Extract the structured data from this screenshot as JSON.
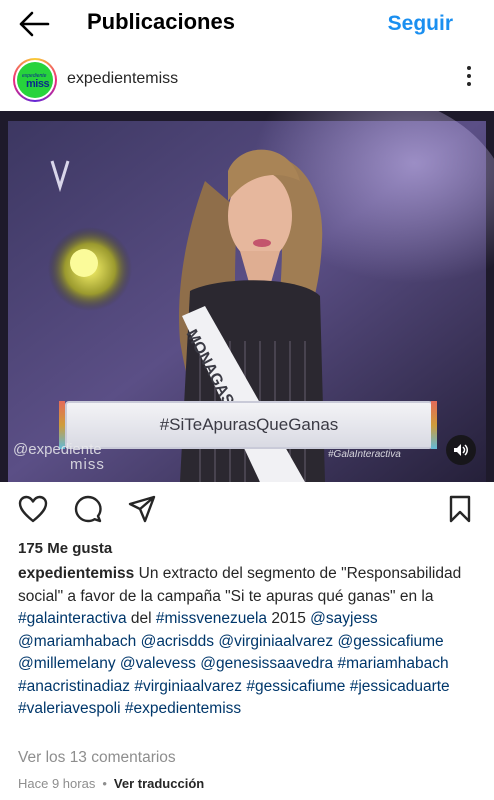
{
  "header": {
    "title": "Publicaciones",
    "follow_label": "Seguir",
    "back_icon": "arrow-left-icon"
  },
  "post": {
    "username": "expedientemiss",
    "avatar": {
      "small_text": "expediente",
      "miss_text": "miss"
    },
    "media": {
      "banner_text": "#SiTeApurasQueGanas",
      "watermark_left": "@expediente",
      "watermark_left_miss": "miss",
      "watermark_right": "#GalaInteractiva",
      "sash_text": "MONAGAS"
    },
    "likes": "175 Me gusta",
    "caption": {
      "username": "expedientemiss",
      "segments": [
        {
          "text": " Un extracto del segmento de \"Responsabilidad social\" a favor de la campaña \"Si te apuras qué ganas\" en la ",
          "link": false
        },
        {
          "text": "#galainteractiva",
          "link": true
        },
        {
          "text": " del ",
          "link": false
        },
        {
          "text": "#missvenezuela",
          "link": true
        },
        {
          "text": " 2015 ",
          "link": false
        },
        {
          "text": "@sayjess",
          "link": true
        },
        {
          "text": " ",
          "link": false
        },
        {
          "text": "@mariamhabach",
          "link": true
        },
        {
          "text": " ",
          "link": false
        },
        {
          "text": "@acrisdds",
          "link": true
        },
        {
          "text": " ",
          "link": false
        },
        {
          "text": "@virginiaalvarez",
          "link": true
        },
        {
          "text": " ",
          "link": false
        },
        {
          "text": "@gessicafiume",
          "link": true
        },
        {
          "text": " ",
          "link": false
        },
        {
          "text": "@millemelany",
          "link": true
        },
        {
          "text": " ",
          "link": false
        },
        {
          "text": "@valevess",
          "link": true
        },
        {
          "text": " ",
          "link": false
        },
        {
          "text": "@genesissaavedra",
          "link": true
        },
        {
          "text": " ",
          "link": false
        },
        {
          "text": "#mariamhabach",
          "link": true
        },
        {
          "text": " ",
          "link": false
        },
        {
          "text": "#anacristinadiaz",
          "link": true
        },
        {
          "text": " ",
          "link": false
        },
        {
          "text": "#virginiaalvarez",
          "link": true
        },
        {
          "text": " ",
          "link": false
        },
        {
          "text": "#gessicafiume",
          "link": true
        },
        {
          "text": " ",
          "link": false
        },
        {
          "text": "#jessicaduarte",
          "link": true
        },
        {
          "text": " ",
          "link": false
        },
        {
          "text": "#valeriavespoli",
          "link": true
        },
        {
          "text": " ",
          "link": false
        },
        {
          "text": "#expedientemiss",
          "link": true
        }
      ]
    },
    "comments_link": "Ver los 13 comentarios",
    "time_ago": "Hace 9 horas",
    "separator": "•",
    "translate_label": "Ver traducción"
  },
  "icons": {
    "like": "heart-icon",
    "comment": "comment-icon",
    "share": "send-icon",
    "save": "bookmark-icon",
    "more": "more-vertical-icon",
    "volume": "speaker-icon"
  },
  "colors": {
    "accent": "#1a8ff0",
    "link": "#00376b",
    "muted": "#8e8e8e",
    "text": "#262626"
  }
}
